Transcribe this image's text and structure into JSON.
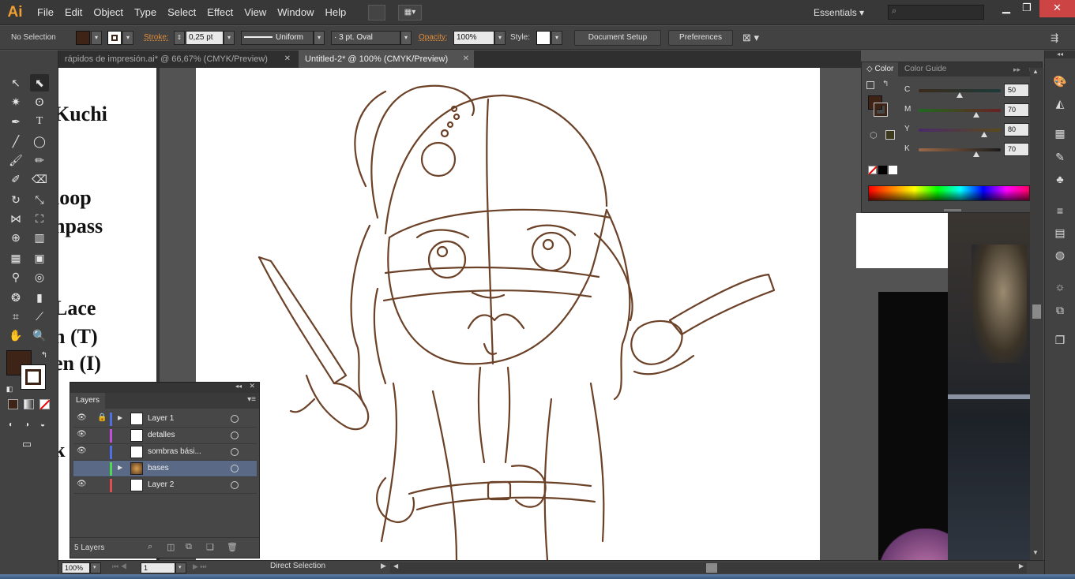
{
  "app": {
    "logo": "Ai"
  },
  "menu": {
    "items": [
      "File",
      "Edit",
      "Object",
      "Type",
      "Select",
      "Effect",
      "View",
      "Window",
      "Help"
    ],
    "workspace": "Essentials",
    "search_placeholder": ""
  },
  "control": {
    "selection": "No Selection",
    "stroke_label": "Stroke:",
    "stroke_value": "0,25 pt",
    "profile": "Uniform",
    "brush": "3 pt. Oval",
    "opacity_label": "Opacity:",
    "opacity_value": "100%",
    "style_label": "Style:",
    "document_setup": "Document Setup",
    "preferences": "Preferences",
    "fill_color": "#3e2416"
  },
  "tabs": [
    {
      "label": "rápidos de impresión.ai* @ 66,67% (CMYK/Preview)",
      "active": false
    },
    {
      "label": "Untitled-2* @ 100% (CMYK/Preview)",
      "active": true
    }
  ],
  "document_text": [
    "Kuchi",
    "loop",
    "npass",
    "Lace",
    "n (T)",
    "en (I)",
    "k s"
  ],
  "color_panel": {
    "tab_color": "Color",
    "tab_guide": "Color Guide",
    "sliders": [
      {
        "label": "C",
        "value": "50",
        "fraction": 0.5,
        "track": "linear-gradient(to right,#3b2a1a,#1c3a3a)"
      },
      {
        "label": "M",
        "value": "70",
        "fraction": 0.7,
        "track": "linear-gradient(to right,#1f6a1f,#6a1f24)"
      },
      {
        "label": "Y",
        "value": "80",
        "fraction": 0.8,
        "track": "linear-gradient(to right,#4a2a6a,#5a4a1a)"
      },
      {
        "label": "K",
        "value": "70",
        "fraction": 0.7,
        "track": "linear-gradient(to right,#9a6a4a,#1a1a1a)"
      }
    ],
    "percent": "%"
  },
  "layers": {
    "title": "Layers",
    "count": "5 Layers",
    "rows": [
      {
        "name": "Layer 1",
        "color": "#4f6fe6",
        "locked": true,
        "expand": true,
        "selected": false
      },
      {
        "name": "detalles",
        "color": "#c04fd9",
        "locked": false,
        "expand": false,
        "selected": false
      },
      {
        "name": "sombras bási...",
        "color": "#4f6fe6",
        "locked": false,
        "expand": false,
        "selected": false
      },
      {
        "name": "bases",
        "color": "#4fd94f",
        "locked": false,
        "expand": true,
        "selected": true
      },
      {
        "name": "Layer 2",
        "color": "#e04f4f",
        "locked": false,
        "expand": false,
        "selected": false
      }
    ]
  },
  "status": {
    "zoom": "100%",
    "artboard": "1",
    "tool": "Direct Selection"
  },
  "icons": {
    "tools": [
      "selection-icon",
      "direct-selection-icon",
      "magic-wand-icon",
      "lasso-icon",
      "pen-icon",
      "type-icon",
      "line-icon",
      "ellipse-icon",
      "paintbrush-icon",
      "pencil-icon",
      "blob-brush-icon",
      "eraser-icon",
      "rotate-icon",
      "scale-icon",
      "width-icon",
      "free-transform-icon",
      "shape-builder-icon",
      "perspective-icon",
      "mesh-icon",
      "gradient-icon",
      "eyedropper-icon",
      "blend-icon",
      "symbol-sprayer-icon",
      "graph-icon",
      "artboard-icon",
      "slice-icon",
      "hand-icon",
      "zoom-icon"
    ],
    "dock": [
      "color-icon",
      "color-guide-icon",
      "swatches-icon",
      "brushes-icon",
      "symbols-icon",
      "stroke-icon",
      "gradient-panel-icon",
      "transparency-icon",
      "appearance-icon",
      "graphic-styles-icon",
      "layers-panel-icon"
    ]
  }
}
